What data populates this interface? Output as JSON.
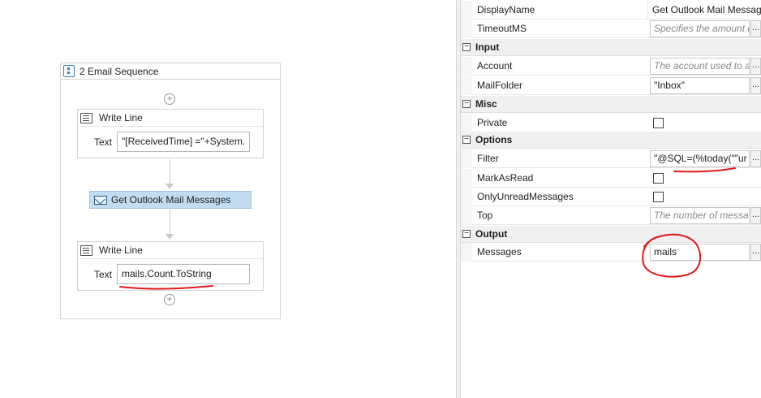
{
  "designer": {
    "sequence_title": "2 Email Sequence",
    "write_line_1": {
      "title": "Write Line",
      "text_label": "Text",
      "text_value": "\"[ReceivedTime] =\"+System."
    },
    "get_outlook": {
      "title": "Get Outlook Mail Messages"
    },
    "write_line_2": {
      "title": "Write Line",
      "text_label": "Text",
      "text_value": "mails.Count.ToString"
    },
    "add_symbol": "+"
  },
  "properties": {
    "ellipsis": "...",
    "checkbox_glyph": "",
    "rows": {
      "display_name": {
        "name": "DisplayName",
        "value": "Get Outlook Mail Messag"
      },
      "timeout_ms": {
        "name": "TimeoutMS",
        "placeholder": "Specifies the amount o"
      },
      "account": {
        "name": "Account",
        "placeholder": "The account used to a"
      },
      "mail_folder": {
        "name": "MailFolder",
        "value": "\"Inbox\""
      },
      "private": {
        "name": "Private",
        "checked": false
      },
      "filter": {
        "name": "Filter",
        "value": "\"@SQL=(%today(\"\"ur"
      },
      "mark_as_read": {
        "name": "MarkAsRead",
        "checked": false
      },
      "only_unread": {
        "name": "OnlyUnreadMessages",
        "checked": false
      },
      "top": {
        "name": "Top",
        "placeholder": "The number of messa"
      },
      "messages": {
        "name": "Messages",
        "value": "mails"
      }
    },
    "categories": {
      "input": {
        "title": "Input",
        "toggle": "−"
      },
      "misc": {
        "title": "Misc",
        "toggle": "−"
      },
      "options": {
        "title": "Options",
        "toggle": "−"
      },
      "output": {
        "title": "Output",
        "toggle": "−"
      }
    }
  },
  "colors": {
    "selected_activity": "#c1dcf1",
    "annotation_red": "#e01818"
  }
}
